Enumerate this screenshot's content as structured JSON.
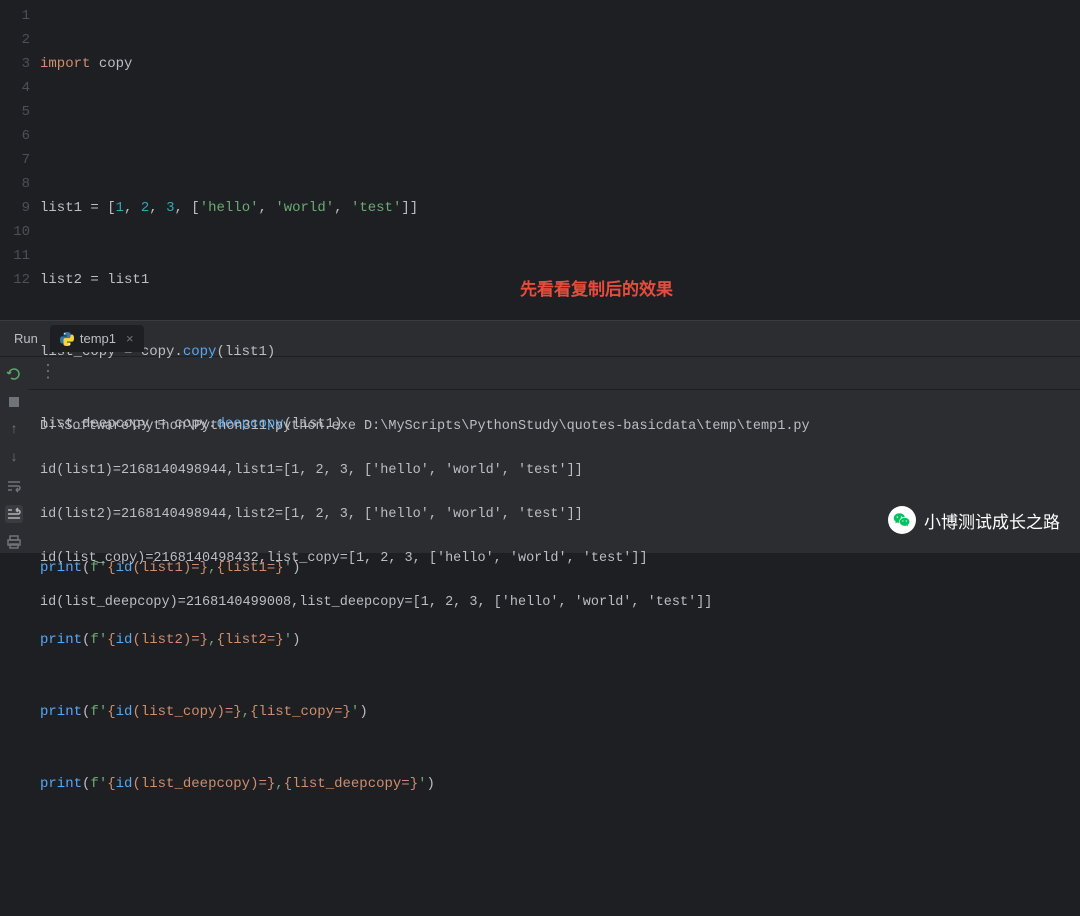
{
  "gutter": [
    "1",
    "2",
    "3",
    "4",
    "5",
    "6",
    "7",
    "8",
    "9",
    "10",
    "11",
    "12"
  ],
  "code": {
    "l1": {
      "kw": "import",
      "sp": " ",
      "mod": "copy"
    },
    "l3": {
      "a": "list1 = [",
      "n1": "1",
      "c1": ", ",
      "n2": "2",
      "c2": ", ",
      "n3": "3",
      "c3": ", [",
      "s1": "'hello'",
      "c4": ", ",
      "s2": "'world'",
      "c5": ", ",
      "s3": "'test'",
      "end": "]]"
    },
    "l4": "list2 = list1",
    "l5": {
      "a": "list_copy = copy.",
      "fn": "copy",
      "b": "(list1)"
    },
    "l6": {
      "a": "list_deepcopy = copy.",
      "fn": "deepcopy",
      "b": "(list1)"
    },
    "l8": {
      "p": "print",
      "a": "(",
      "f": "f'",
      "b": "{",
      "id": "id",
      "c": "(list1)=}",
      "d": ",",
      "e": "{list1=}",
      "g": "'",
      "h": ")"
    },
    "l9": {
      "p": "print",
      "a": "(",
      "f": "f'",
      "b": "{",
      "id": "id",
      "c": "(list2)=}",
      "d": ",",
      "e": "{list2=}",
      "g": "'",
      "h": ")"
    },
    "l10": {
      "p": "print",
      "a": "(",
      "f": "f'",
      "b": "{",
      "id": "id",
      "c": "(list_copy)=}",
      "d": ",",
      "e": "{list_copy=}",
      "g": "'",
      "h": ")"
    },
    "l11": {
      "p": "print",
      "a": "(",
      "f": "f'",
      "b": "{",
      "id": "id",
      "c": "(list_deepcopy)=}",
      "d": ",",
      "e": "{list_deepcopy=}",
      "g": "'",
      "h": ")"
    }
  },
  "annotation": "先看看复制后的效果",
  "run": {
    "label": "Run",
    "tab_name": "temp1",
    "close": "×"
  },
  "console": {
    "l1": "D:\\Software\\Python\\Python311\\python.exe D:\\MyScripts\\PythonStudy\\quotes-basicdata\\temp\\temp1.py",
    "l2": "id(list1)=2168140498944,list1=[1, 2, 3, ['hello', 'world', 'test']]",
    "l3": "id(list2)=2168140498944,list2=[1, 2, 3, ['hello', 'world', 'test']]",
    "l4": "id(list_copy)=2168140498432,list_copy=[1, 2, 3, ['hello', 'world', 'test']]",
    "l5": "id(list_deepcopy)=2168140499008,list_deepcopy=[1, 2, 3, ['hello', 'world', 'test']]"
  },
  "watermark": "小博测试成长之路"
}
